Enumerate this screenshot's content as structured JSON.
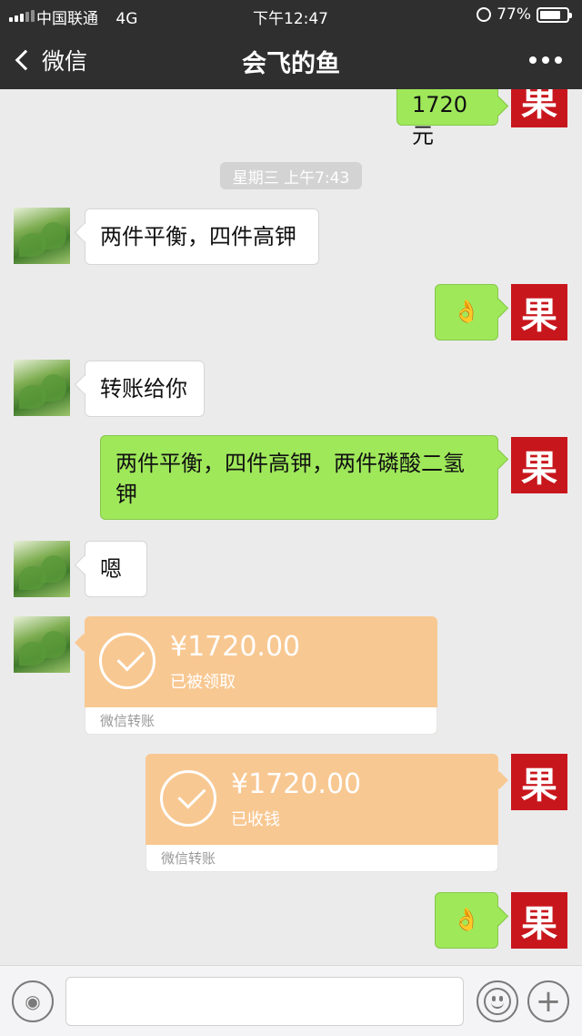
{
  "status_bar": {
    "carrier": "中国联通",
    "network": "4G",
    "time": "下午12:47",
    "battery_percent": "77%",
    "battery_level": 0.77
  },
  "nav": {
    "back_label": "微信",
    "title": "会飞的鱼",
    "more_icon": "more-dots-icon"
  },
  "colors": {
    "my_bubble": "#9fe85a",
    "transfer_card": "#f8c892",
    "my_avatar": "#c8161d",
    "top_bar": "#2f2f2f"
  },
  "my_avatar_char": "果",
  "messages": {
    "m0_text": "1720元",
    "timestamp": "星期三 上午7:43",
    "m1_text": "两件平衡，四件高钾",
    "m2_emoji": "👌",
    "m3_text": "转账给你",
    "m4_line1": "两件平衡，四件高钾，两件磷酸二氢",
    "m4_line2": "钾",
    "m5_text": "嗯",
    "t1_amount": "¥1720.00",
    "t1_state": "已被领取",
    "t1_footer": "微信转账",
    "t2_amount": "¥1720.00",
    "t2_state": "已收钱",
    "t2_footer": "微信转账",
    "m6_emoji": "👌"
  },
  "input_bar": {
    "voice_icon": "voice-icon",
    "emoji_icon": "emoji-icon",
    "plus_icon": "plus-icon",
    "input_value": ""
  }
}
